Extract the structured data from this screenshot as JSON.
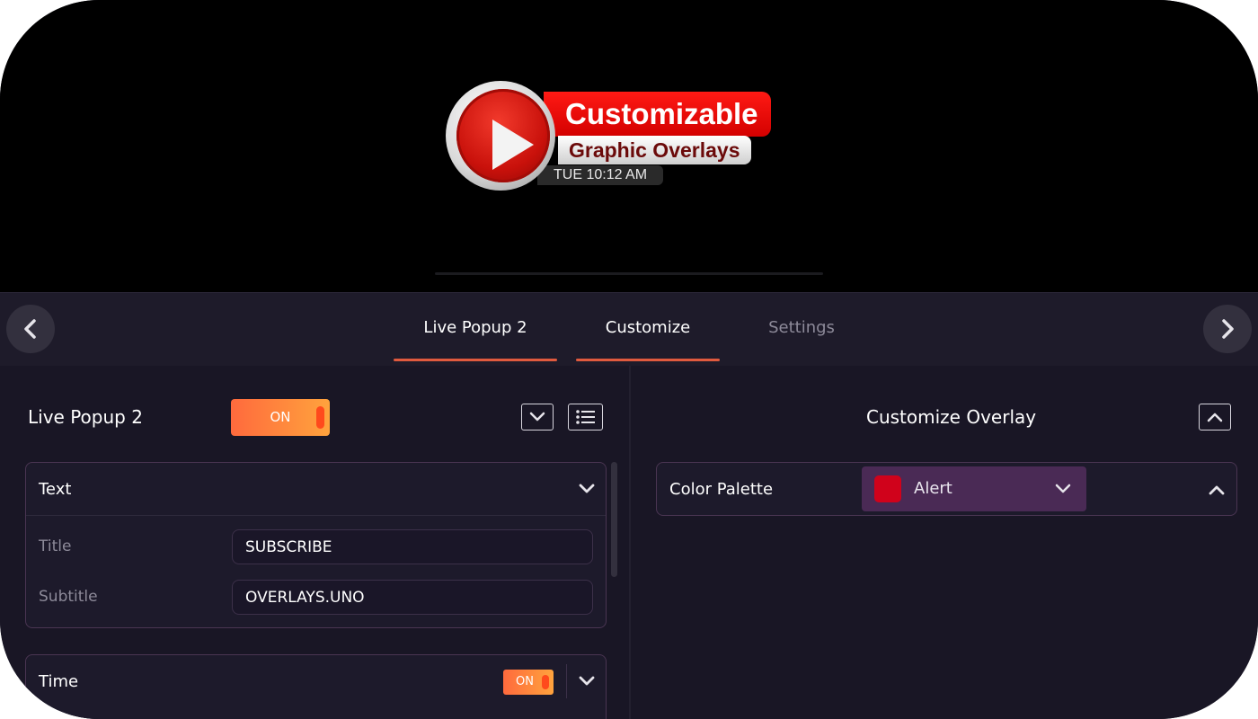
{
  "preview": {
    "overlay_title": "Customizable",
    "overlay_subtitle": "Graphic Overlays",
    "overlay_time": "TUE 10:12 AM"
  },
  "nav": {
    "prev_icon": "chevron-left-icon",
    "next_icon": "chevron-right-icon",
    "tabs": [
      {
        "label": "Live Popup 2",
        "active": true
      },
      {
        "label": "Customize",
        "active": true
      },
      {
        "label": "Settings",
        "active": false
      }
    ]
  },
  "left_panel": {
    "title": "Live Popup 2",
    "toggle_label": "ON",
    "collapse_icon": "chevron-down-icon",
    "list_icon": "list-icon",
    "text_section": {
      "label": "Text",
      "fields": [
        {
          "label": "Title",
          "value": "SUBSCRIBE"
        },
        {
          "label": "Subtitle",
          "value": "OVERLAYS.UNO"
        }
      ]
    },
    "time_section": {
      "label": "Time",
      "toggle_label": "ON"
    }
  },
  "right_panel": {
    "title": "Customize Overlay",
    "collapse_icon": "chevron-up-icon",
    "color_palette": {
      "label": "Color Palette",
      "selected": "Alert",
      "swatch_color": "#d0021b"
    }
  },
  "colors": {
    "accent": "#e05a3e",
    "toggle_start": "#ff6a3d",
    "toggle_end": "#ffa33d",
    "panel_bg": "#191625",
    "select_bg": "#4a2a55"
  }
}
